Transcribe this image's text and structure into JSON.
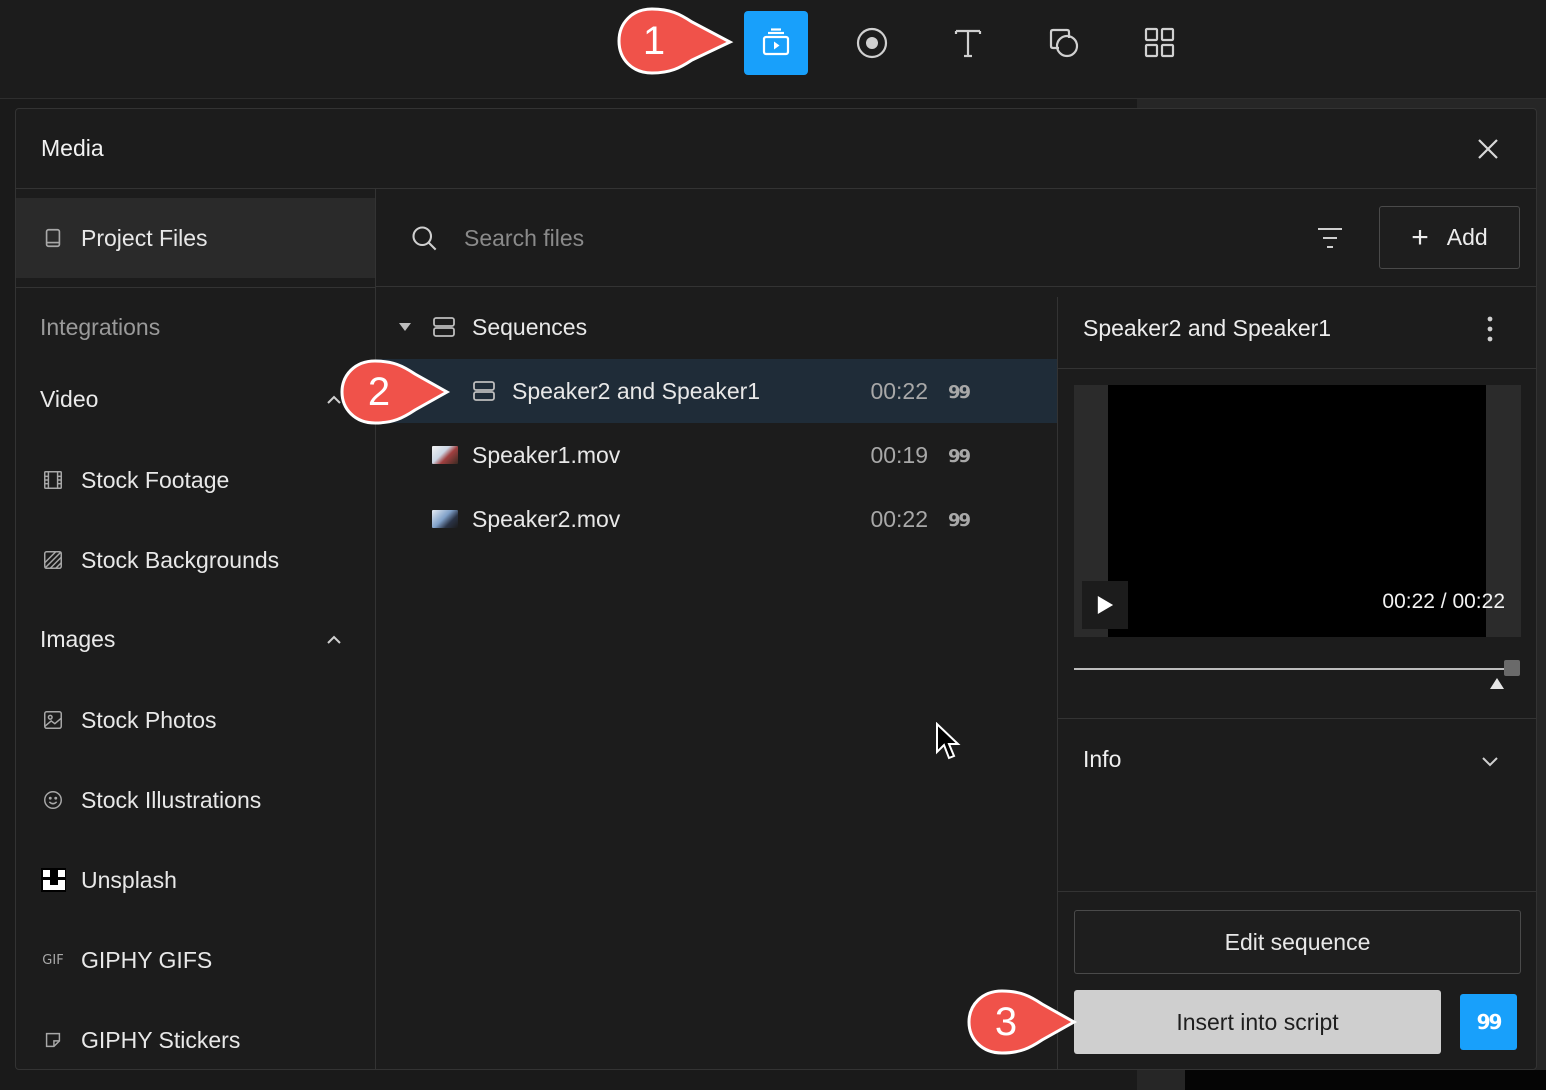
{
  "toolbar": {
    "tools": [
      {
        "name": "media",
        "active": true
      },
      {
        "name": "record"
      },
      {
        "name": "text"
      },
      {
        "name": "shapes"
      },
      {
        "name": "templates"
      }
    ]
  },
  "panel": {
    "title": "Media",
    "sidebar": {
      "project_files": "Project Files",
      "integrations_heading": "Integrations",
      "video_group": "Video",
      "stock_footage": "Stock Footage",
      "stock_backgrounds": "Stock Backgrounds",
      "images_group": "Images",
      "stock_photos": "Stock Photos",
      "stock_illustrations": "Stock Illustrations",
      "unsplash": "Unsplash",
      "giphy_gifs": "GIPHY GIFS",
      "giphy_gif_icon_text": "GIF",
      "giphy_stickers": "GIPHY Stickers"
    },
    "search": {
      "placeholder": "Search files",
      "add_label": "Add"
    },
    "files": {
      "folder": "Sequences",
      "items": [
        {
          "name": "Speaker2 and Speaker1",
          "duration": "00:22",
          "selected": true
        },
        {
          "name": "Speaker1.mov",
          "duration": "00:19"
        },
        {
          "name": "Speaker2.mov",
          "duration": "00:22"
        }
      ]
    },
    "preview": {
      "title": "Speaker2 and Speaker1",
      "time_readout": "00:22 / 00:22",
      "progress": 1.0,
      "info_label": "Info",
      "edit_label": "Edit sequence",
      "insert_label": "Insert into script"
    }
  },
  "callouts": [
    "1",
    "2",
    "3"
  ],
  "colors": {
    "accent": "#18a0fb",
    "callout": "#f0524a",
    "selection": "#1f2c38"
  }
}
